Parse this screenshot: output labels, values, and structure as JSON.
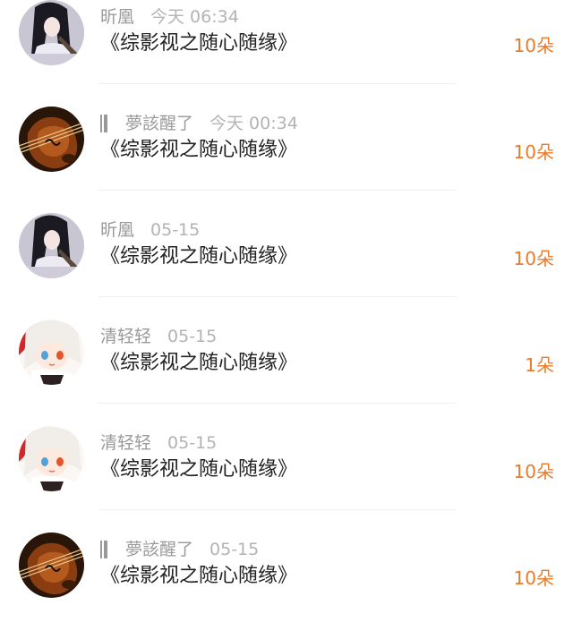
{
  "rows": [
    {
      "avatar": "girl-dark-hair-avatar",
      "user_prefix_icon": "",
      "user": "昕凰",
      "time": "今天 06:34",
      "title": "《综影视之随心随缘》",
      "amount": "10朵"
    },
    {
      "avatar": "violin-avatar",
      "user_prefix_icon": "signal-bars-icon",
      "user": "夢該醒了",
      "time": "今天 00:34",
      "title": "《综影视之随心随缘》",
      "amount": "10朵"
    },
    {
      "avatar": "girl-dark-hair-avatar",
      "user_prefix_icon": "",
      "user": "昕凰",
      "time": "05-15",
      "title": "《综影视之随心随缘》",
      "amount": "10朵"
    },
    {
      "avatar": "anime-white-hair-avatar",
      "user_prefix_icon": "",
      "user": "清轻轻",
      "time": "05-15",
      "title": "《综影视之随心随缘》",
      "amount": "1朵"
    },
    {
      "avatar": "anime-white-hair-avatar",
      "user_prefix_icon": "",
      "user": "清轻轻",
      "time": "05-15",
      "title": "《综影视之随心随缘》",
      "amount": "10朵"
    },
    {
      "avatar": "violin-avatar",
      "user_prefix_icon": "signal-bars-icon",
      "user": "夢該醒了",
      "time": "05-15",
      "title": "《综影视之随心随缘》",
      "amount": "10朵"
    }
  ],
  "colors": {
    "amount": "#e97b2a",
    "meta": "#9a9a9a",
    "title": "#222222"
  }
}
